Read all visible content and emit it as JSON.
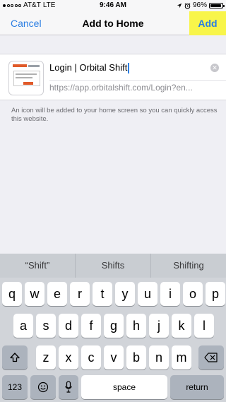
{
  "status": {
    "carrier": "AT&T",
    "network": "LTE",
    "time": "9:46 AM",
    "battery": "96%",
    "battery_level": 0.96,
    "signal_icon": "signal-dots-icon",
    "location_icon": "location-arrow-icon",
    "alarm_icon": "alarm-clock-icon"
  },
  "nav": {
    "cancel_label": "Cancel",
    "title": "Add to Home",
    "add_label": "Add"
  },
  "bookmark": {
    "title": "Login | Orbital Shift",
    "url": "https://app.orbitalshift.com/Login?en...",
    "clear_icon": "clear-icon"
  },
  "hint_text": "An icon will be added to your home screen so you can quickly access this website.",
  "keyboard": {
    "suggestions": [
      "“Shift”",
      "Shifts",
      "Shifting"
    ],
    "row1": [
      "q",
      "w",
      "e",
      "r",
      "t",
      "y",
      "u",
      "i",
      "o",
      "p"
    ],
    "row2": [
      "a",
      "s",
      "d",
      "f",
      "g",
      "h",
      "j",
      "k",
      "l"
    ],
    "row3": [
      "z",
      "x",
      "c",
      "v",
      "b",
      "n",
      "m"
    ],
    "numbers_label": "123",
    "space_label": "space",
    "return_label": "return",
    "shift_icon": "shift-icon",
    "delete_icon": "delete-icon",
    "emoji_icon": "emoji-icon",
    "mic_icon": "microphone-icon"
  },
  "colors": {
    "accent": "#2a7ee3",
    "highlight": "#f8f54a"
  }
}
